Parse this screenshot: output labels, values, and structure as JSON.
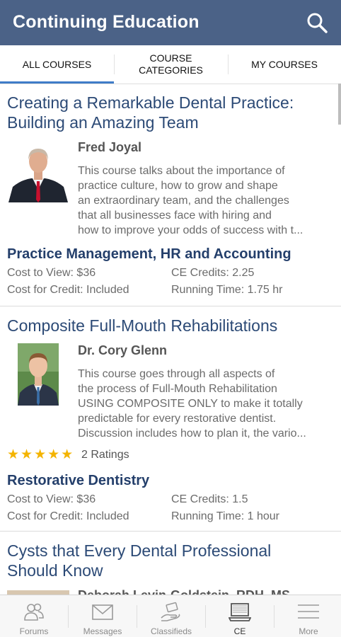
{
  "header": {
    "title": "Continuing Education",
    "search_icon": "search-icon"
  },
  "tabs": [
    {
      "label": "ALL COURSES",
      "selected": true
    },
    {
      "label": "COURSE CATEGORIES",
      "selected": false
    },
    {
      "label": "MY COURSES",
      "selected": false
    }
  ],
  "courses": [
    {
      "title_line1": "Creating a Remarkable Dental Practice:",
      "title_line2": "Building an Amazing Team",
      "instructor": "Fred Joyal",
      "description": [
        "This course talks about the importance of",
        "practice culture, how to grow and shape",
        "an extraordinary team, and the challenges",
        "that all businesses face with hiring and",
        "how to improve your odds of success with t..."
      ],
      "category": "Practice Management, HR and Accounting",
      "cost_to_view": "Cost to View: $36",
      "ce_credits": "CE Credits: 2.25",
      "cost_for_credit": "Cost for Credit: Included",
      "running_time": "Running Time: 1.75 hr"
    },
    {
      "title_line1": "Composite Full-Mouth Rehabilitations",
      "instructor": "Dr. Cory Glenn",
      "description": [
        "This course goes through all aspects of",
        "the process of Full-Mouth Rehabilitation",
        "USING COMPOSITE ONLY to make it totally",
        "predictable for every restorative dentist.",
        "Discussion includes how to plan it, the vario..."
      ],
      "rating_stars": 5,
      "ratings": "2 Ratings",
      "category": "Restorative Dentistry",
      "cost_to_view": "Cost to View: $36",
      "ce_credits": "CE Credits: 1.5",
      "cost_for_credit": "Cost for Credit: Included",
      "running_time": "Running Time: 1 hour"
    },
    {
      "title_line1": "Cysts that Every Dental Professional",
      "title_line2": "Should Know",
      "instructor": "Deborah Levin-Goldstein, RDH, MS"
    }
  ],
  "bottom_nav": [
    {
      "label": "Forums",
      "icon": "people-icon"
    },
    {
      "label": "Messages",
      "icon": "envelope-icon"
    },
    {
      "label": "Classifieds",
      "icon": "hand-money-icon"
    },
    {
      "label": "CE",
      "icon": "laptop-icon",
      "active": true
    },
    {
      "label": "More",
      "icon": "menu-icon"
    }
  ],
  "colors": {
    "header": "#4b6287",
    "title": "#2c4a76",
    "category": "#243f6b",
    "tab_underline": "#3f7cc8",
    "star": "#f4b400"
  }
}
